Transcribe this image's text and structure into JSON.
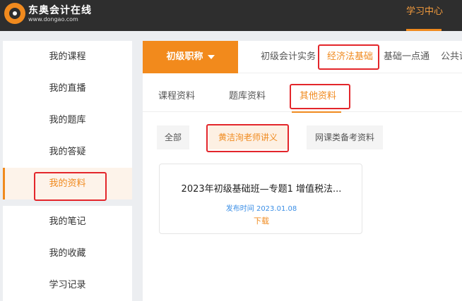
{
  "header": {
    "logo_name": "东奥会计在线",
    "logo_url": "www.dongao.com",
    "nav_label": "学习中心"
  },
  "sidebar": {
    "items": [
      {
        "label": "我的课程"
      },
      {
        "label": "我的直播"
      },
      {
        "label": "我的题库"
      },
      {
        "label": "我的答疑"
      },
      {
        "label": "我的资料"
      },
      {
        "label": "我的笔记"
      },
      {
        "label": "我的收藏"
      },
      {
        "label": "学习记录"
      }
    ],
    "active": "我的资料"
  },
  "main": {
    "level_label": "初级职称",
    "course_tabs": [
      {
        "label": "初级会计实务"
      },
      {
        "label": "经济法基础"
      },
      {
        "label": "基础一点通"
      },
      {
        "label": "公共课"
      }
    ],
    "resource_tabs": [
      {
        "label": "课程资料"
      },
      {
        "label": "题库资料"
      },
      {
        "label": "其他资料"
      }
    ],
    "chips": [
      {
        "label": "全部"
      },
      {
        "label": "黄洁洵老师讲义"
      },
      {
        "label": "网课类备考资料"
      }
    ],
    "card": {
      "title": "2023年初级基础班—专题1 增值税法...",
      "date": "发布时间 2023.01.08",
      "download": "下载"
    }
  },
  "colors": {
    "accent": "#f08a1e",
    "topbar": "#2e2e2e",
    "highlight": "#e3262b",
    "link": "#3a8ee6"
  }
}
